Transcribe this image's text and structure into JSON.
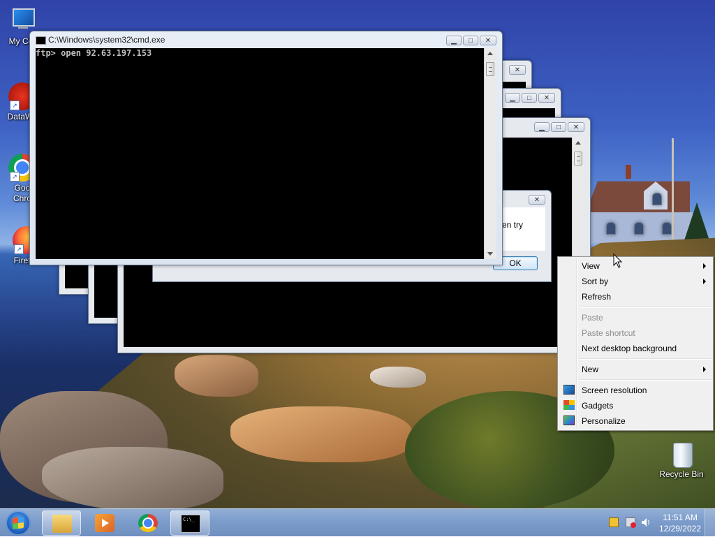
{
  "desktop": {
    "icons": [
      {
        "label": "My Cor"
      },
      {
        "label": "DataWa"
      },
      {
        "label": "Goo",
        "label2": "Chro"
      },
      {
        "label": "Firefox"
      },
      {
        "label": "Recycle Bin"
      }
    ]
  },
  "cmd_window": {
    "title": "C:\\Windows\\system32\\cmd.exe",
    "console_text": "ftp> open 92.63.197.153"
  },
  "dialog": {
    "text": "en try",
    "ok_label": "OK"
  },
  "context_menu": {
    "items": [
      {
        "label": "View",
        "submenu": true
      },
      {
        "label": "Sort by",
        "submenu": true
      },
      {
        "label": "Refresh"
      },
      {
        "label": "Paste",
        "disabled": true
      },
      {
        "label": "Paste shortcut",
        "disabled": true
      },
      {
        "label": "Next desktop background"
      },
      {
        "label": "New",
        "submenu": true
      },
      {
        "label": "Screen resolution",
        "icon": "screen-resolution-icon"
      },
      {
        "label": "Gadgets",
        "icon": "gadgets-icon"
      },
      {
        "label": "Personalize",
        "icon": "personalize-icon"
      }
    ]
  },
  "taskbar": {
    "pinned": [
      "folder-icon",
      "media-player-icon",
      "chrome-icon",
      "cmd-icon"
    ],
    "clock": {
      "time": "11:51 AM",
      "date": "12/29/2022"
    }
  }
}
